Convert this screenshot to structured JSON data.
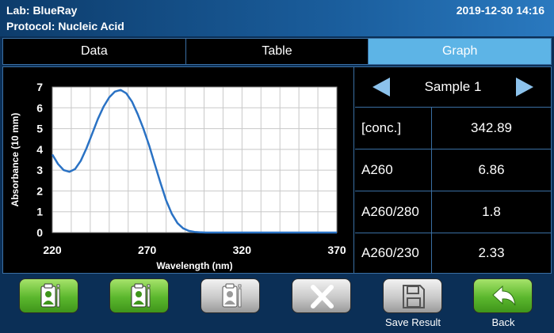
{
  "header": {
    "lab": "Lab: BlueRay",
    "protocol": "Protocol: Nucleic Acid",
    "datetime": "2019-12-30 14:16"
  },
  "tabs": [
    {
      "label": "Data",
      "active": false
    },
    {
      "label": "Table",
      "active": false
    },
    {
      "label": "Graph",
      "active": true
    }
  ],
  "sample": {
    "label": "Sample 1"
  },
  "results": [
    {
      "label": "[conc.]",
      "value": "342.89"
    },
    {
      "label": "A260",
      "value": "6.86"
    },
    {
      "label": "A260/280",
      "value": "1.8"
    },
    {
      "label": "A260/230",
      "value": "2.33"
    }
  ],
  "chart_data": {
    "type": "line",
    "xlabel": "Wavelength (nm)",
    "ylabel": "Absorbance (10 mm)",
    "xlim": [
      220,
      370
    ],
    "ylim": [
      0,
      7
    ],
    "xticks": [
      220,
      270,
      320,
      370
    ],
    "yticks": [
      0,
      1,
      2,
      3,
      4,
      5,
      6,
      7
    ],
    "grid": true,
    "color": "#2a72c4",
    "series": [
      {
        "x": [
          220,
          223,
          226,
          229,
          232,
          235,
          238,
          241,
          244,
          247,
          250,
          253,
          256,
          259,
          262,
          265,
          268,
          271,
          274,
          277,
          280,
          283,
          286,
          289,
          292,
          295,
          298,
          301,
          304,
          307,
          310,
          315,
          320,
          330,
          340,
          350,
          360,
          370
        ],
        "y": [
          3.75,
          3.3,
          3.0,
          2.92,
          3.05,
          3.45,
          4.05,
          4.75,
          5.45,
          6.05,
          6.5,
          6.78,
          6.86,
          6.7,
          6.3,
          5.7,
          5.0,
          4.2,
          3.3,
          2.4,
          1.55,
          0.9,
          0.45,
          0.2,
          0.08,
          0.03,
          0.01,
          0,
          0,
          0,
          0,
          0,
          0,
          0,
          0,
          0,
          0,
          0
        ]
      }
    ]
  },
  "buttons": [
    {
      "name": "green-clipboard-button-1",
      "icon": "clipboard-person-icon",
      "style": "green",
      "caption": ""
    },
    {
      "name": "green-clipboard-button-2",
      "icon": "clipboard-person-icon",
      "style": "green",
      "caption": ""
    },
    {
      "name": "gray-clipboard-button",
      "icon": "clipboard-person-icon",
      "style": "gray",
      "caption": ""
    },
    {
      "name": "delete-button",
      "icon": "close-icon",
      "style": "gray",
      "caption": ""
    },
    {
      "name": "save-result-button",
      "icon": "floppy-disk-icon",
      "style": "gray",
      "caption": "Save Result"
    },
    {
      "name": "back-button",
      "icon": "back-arrow-icon",
      "style": "green",
      "caption": "Back"
    }
  ]
}
